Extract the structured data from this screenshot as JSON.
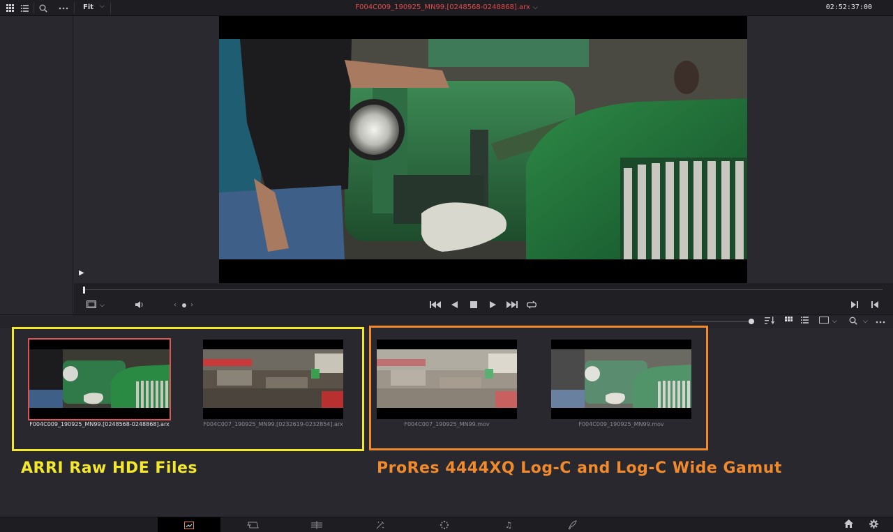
{
  "viewer": {
    "fit_label": "Fit",
    "clip_title": "F004C009_190925_MN99.[0248568-0248868].arx",
    "timecode": "02:52:37:00"
  },
  "media_pool": {
    "clips": [
      {
        "name": "F004C009_190925_MN99.[0248568-0248868].arx",
        "selected": true
      },
      {
        "name": "F004C007_190925_MN99.[0232619-0232854].arx",
        "selected": false
      },
      {
        "name": "F004C007_190925_MN99.mov",
        "selected": false
      },
      {
        "name": "F004C009_190925_MN99.mov",
        "selected": false
      }
    ]
  },
  "annotations": {
    "left_caption": "ARRI Raw HDE Files",
    "right_caption": "ProRes 4444XQ Log-C and Log-C Wide Gamut",
    "left_color": "#f4e82a",
    "right_color": "#f08a2c"
  },
  "icons": {
    "top": [
      "grid-view-icon",
      "list-view-icon",
      "search-icon",
      "more-icon",
      "chevron-down-icon"
    ],
    "transport": [
      "jump-to-start-icon",
      "play-reverse-icon",
      "stop-icon",
      "play-icon",
      "jump-to-end-icon",
      "loop-icon"
    ],
    "pages": [
      "media-page-icon",
      "cut-page-icon",
      "edit-page-icon",
      "fusion-page-icon",
      "color-page-icon",
      "fairlight-page-icon",
      "deliver-page-icon"
    ]
  },
  "accent_red": "#e24a4a"
}
